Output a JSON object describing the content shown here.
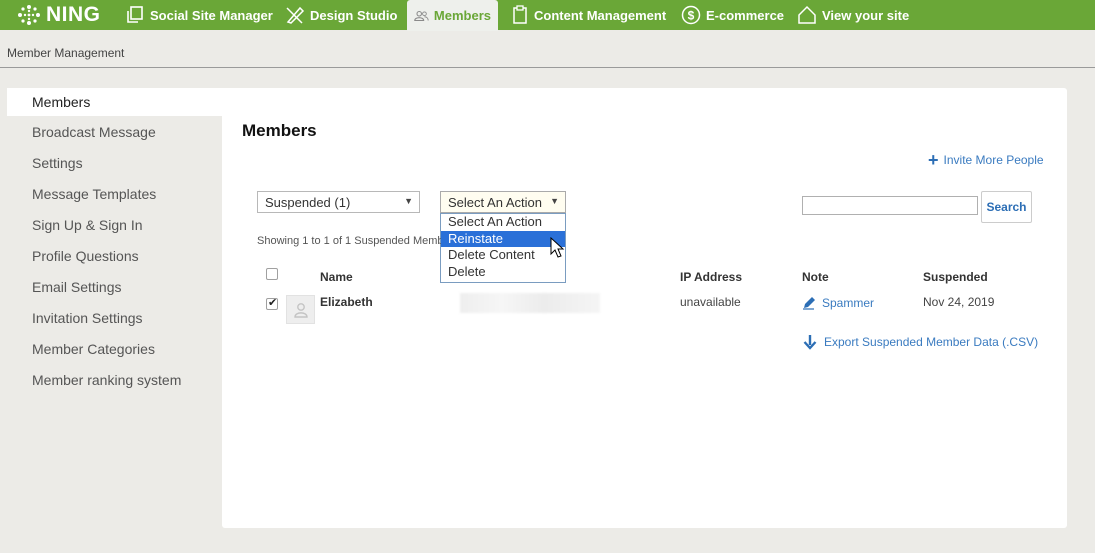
{
  "app": {
    "logo_text": "NING"
  },
  "nav": {
    "items": [
      {
        "label": "Social Site Manager",
        "icon": "copy-icon"
      },
      {
        "label": "Design Studio",
        "icon": "pencil-ruler-icon"
      },
      {
        "label": "Members",
        "icon": "users-icon",
        "active": true
      },
      {
        "label": "Content Management",
        "icon": "clipboard-icon"
      },
      {
        "label": "E-commerce",
        "icon": "dollar-icon"
      },
      {
        "label": "View your site",
        "icon": "home-icon"
      }
    ]
  },
  "breadcrumb": "Member Management",
  "sidebar": {
    "items": [
      {
        "label": "Members",
        "active": true
      },
      {
        "label": "Broadcast Message"
      },
      {
        "label": "Settings"
      },
      {
        "label": "Message Templates"
      },
      {
        "label": "Sign Up & Sign In"
      },
      {
        "label": "Profile Questions"
      },
      {
        "label": "Email Settings"
      },
      {
        "label": "Invitation Settings"
      },
      {
        "label": "Member Categories"
      },
      {
        "label": "Member ranking system"
      }
    ]
  },
  "main": {
    "title": "Members",
    "invite_label": "Invite More People",
    "filter_select": {
      "value": "Suspended (1)"
    },
    "action_select": {
      "value": "Select An Action",
      "options": [
        "Select An Action",
        "Reinstate",
        "Delete Content",
        "Delete"
      ],
      "highlighted": "Reinstate"
    },
    "search": {
      "value": "",
      "button_label": "Search"
    },
    "showing_text": "Showing 1 to 1 of 1 Suspended Members",
    "table": {
      "headers": {
        "name": "Name",
        "ip": "IP Address",
        "note": "Note",
        "suspended": "Suspended"
      },
      "rows": [
        {
          "name": "Elizabeth",
          "ip": "unavailable",
          "note": "Spammer",
          "suspended": "Nov 24, 2019",
          "checked": true
        }
      ]
    },
    "export_label": "Export Suspended Member Data (.CSV)"
  },
  "colors": {
    "brand_green": "#6aa737",
    "link_blue": "#3a7bc0",
    "highlight_blue": "#2a70d8"
  }
}
